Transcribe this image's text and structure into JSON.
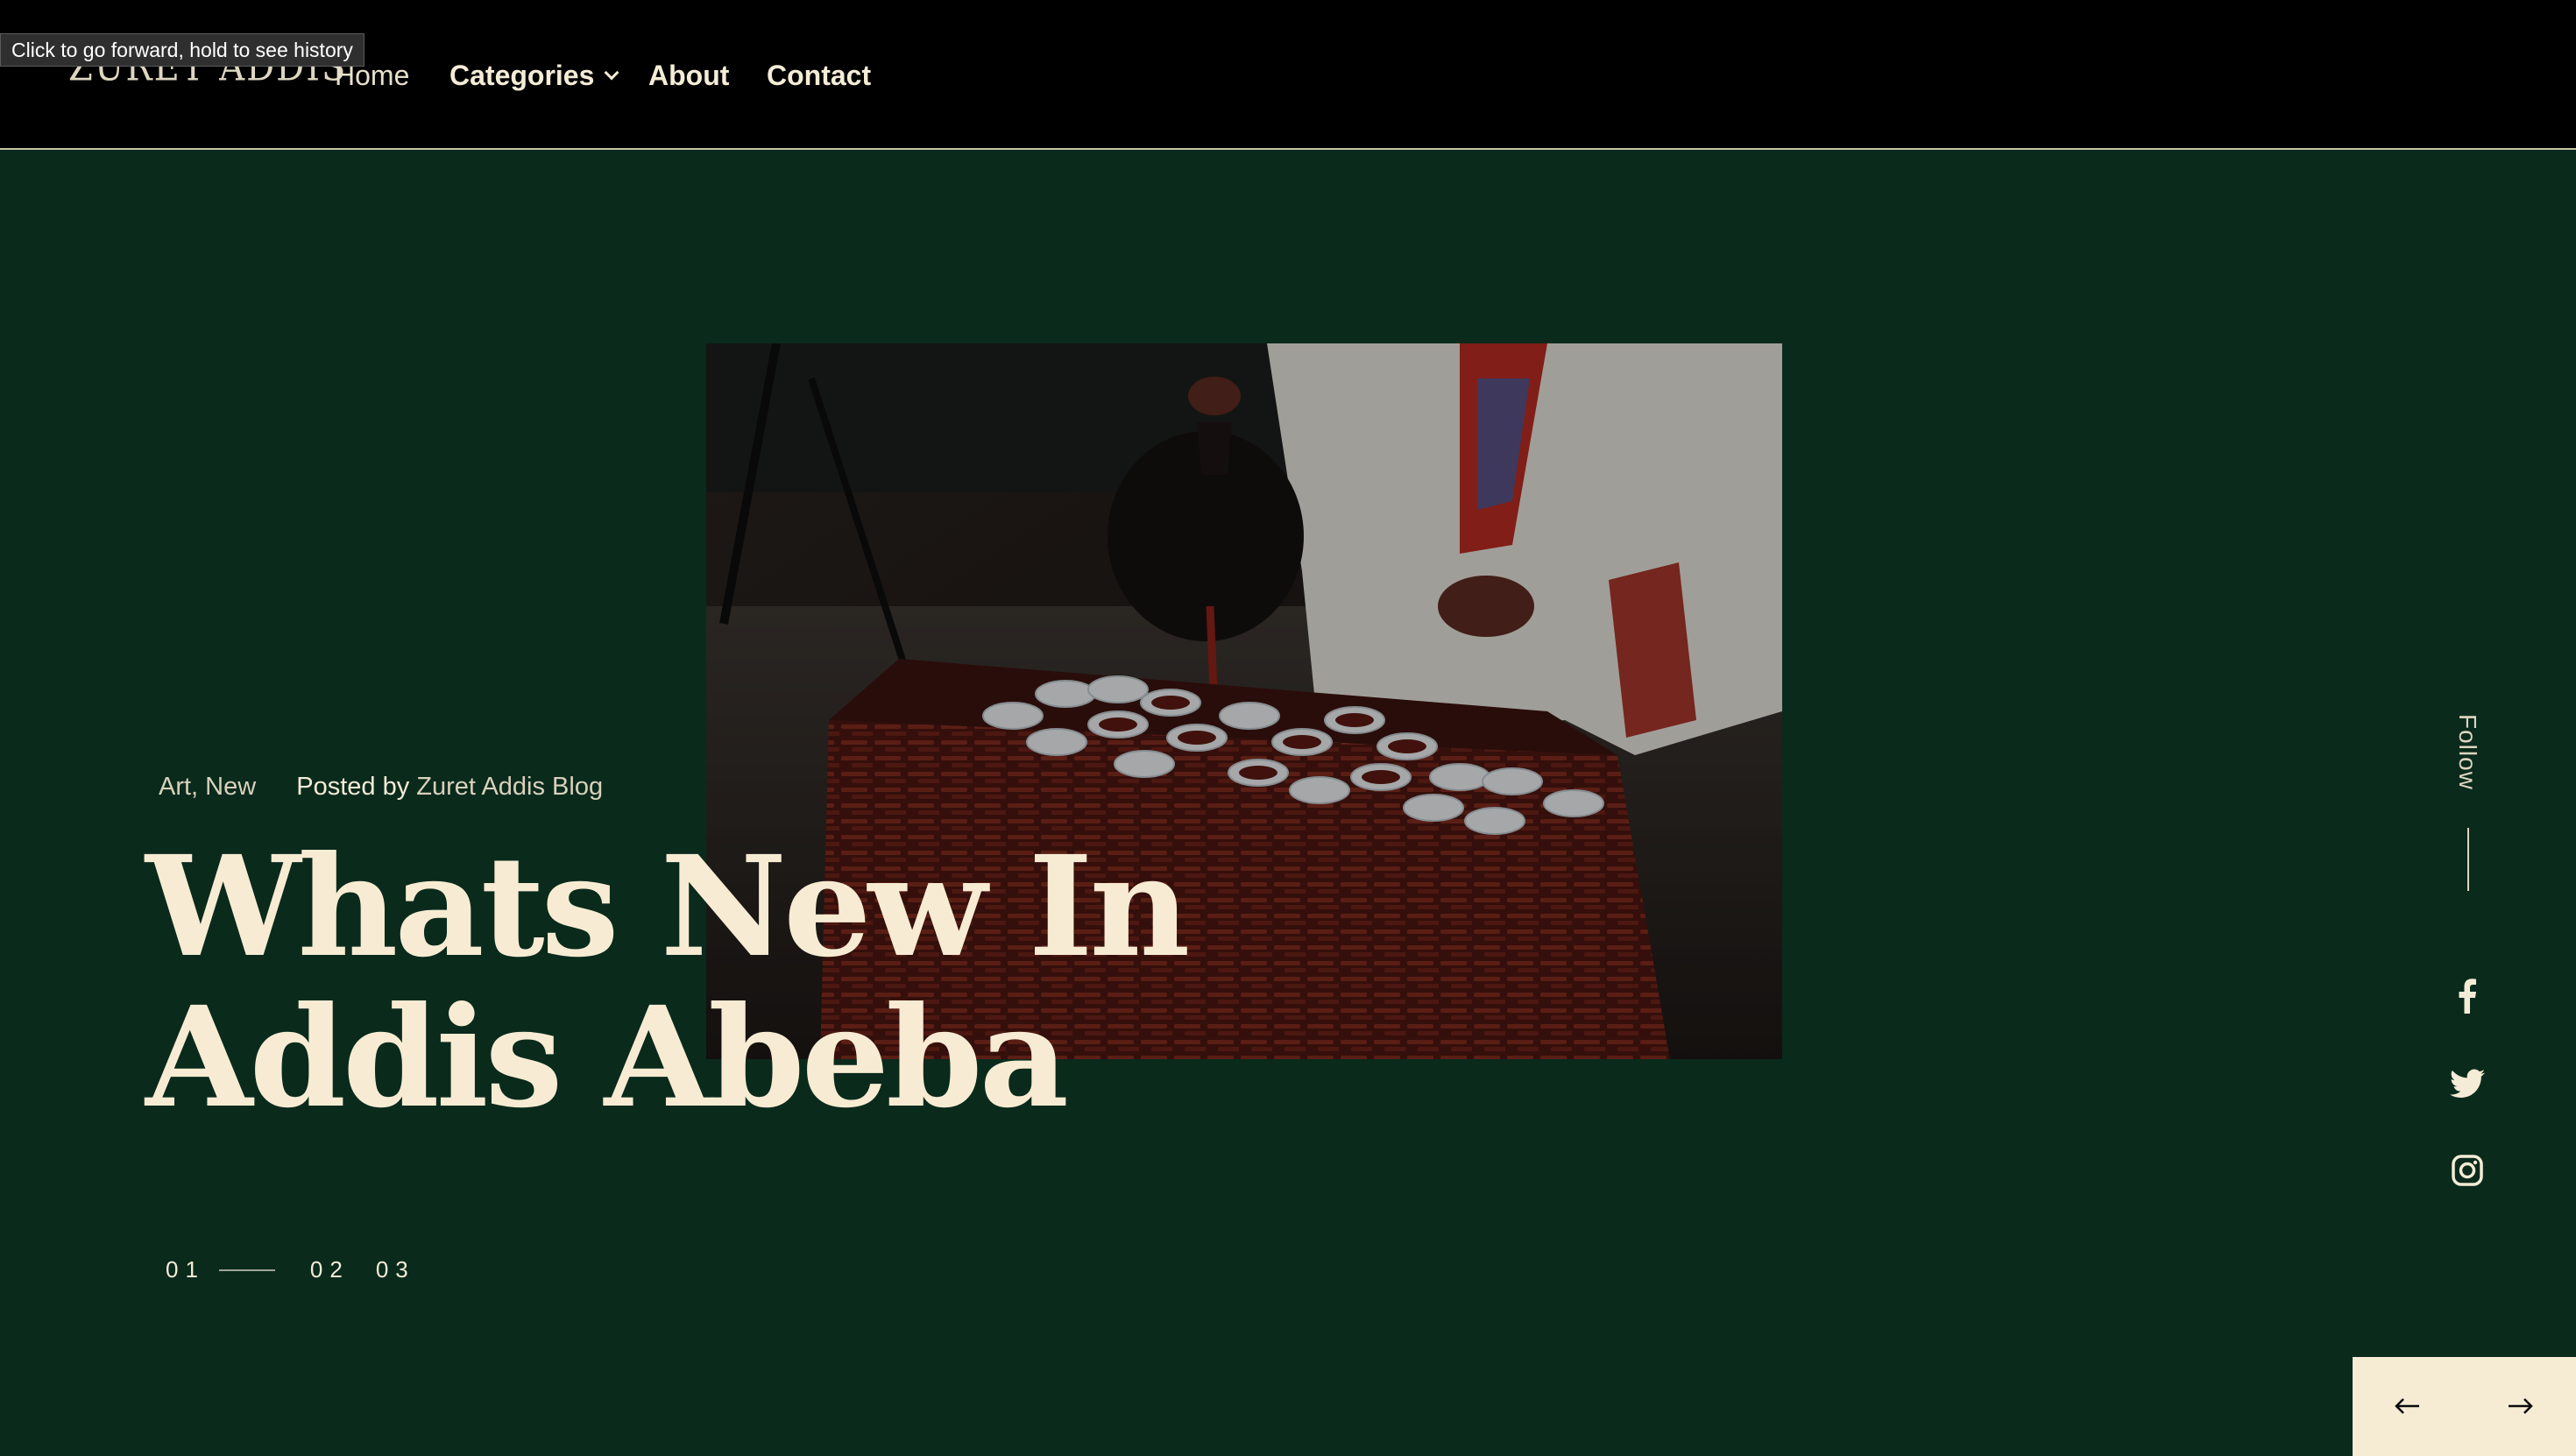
{
  "browser": {
    "tooltip": "Click to go forward, hold to see history"
  },
  "header": {
    "logo": "ZURET ADDIS",
    "nav": {
      "home": "Home",
      "categories": "Categories",
      "about": "About",
      "contact": "Contact"
    }
  },
  "hero": {
    "categories": "Art, New",
    "posted_by_label": "Posted by",
    "author": "Zuret Addis Blog",
    "title": "Whats New In Addis Abeba",
    "slides": [
      "01",
      "02",
      "03"
    ],
    "active_slide": "01"
  },
  "social": {
    "follow_label": "Follow",
    "icons": [
      "facebook-icon",
      "twitter-icon",
      "instagram-icon"
    ]
  },
  "colors": {
    "background": "#0a2a1c",
    "header": "#000000",
    "accent_cream": "#f6ecd4",
    "text": "#f4ecd6"
  }
}
